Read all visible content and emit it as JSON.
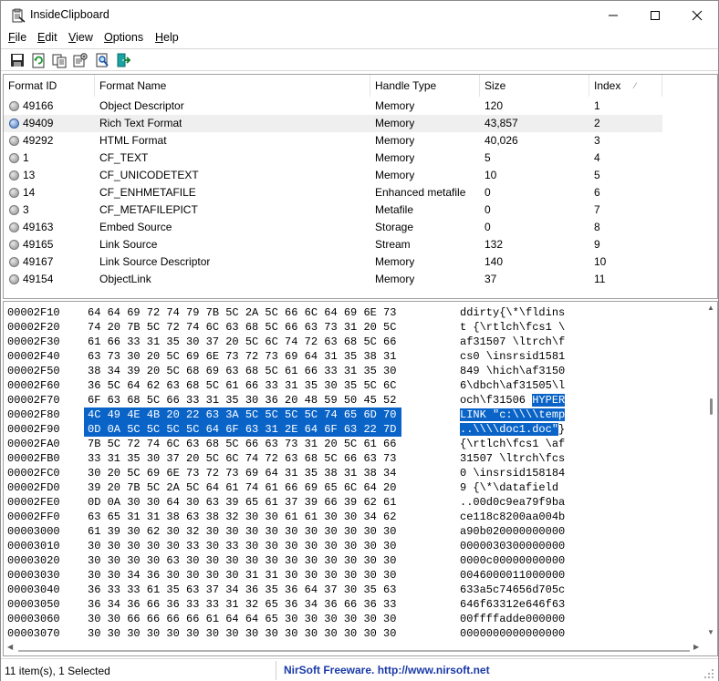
{
  "app": {
    "title": "InsideClipboard"
  },
  "menu": [
    {
      "label": "File",
      "key": "F",
      "rest": "ile"
    },
    {
      "label": "Edit",
      "key": "E",
      "rest": "dit"
    },
    {
      "label": "View",
      "key": "V",
      "rest": "iew"
    },
    {
      "label": "Options",
      "key": "O",
      "rest": "ptions"
    },
    {
      "label": "Help",
      "key": "H",
      "rest": "elp"
    }
  ],
  "toolbar": {
    "buttons": [
      "save-icon",
      "refresh-icon",
      "copy-icon",
      "properties-icon",
      "find-icon",
      "exit-icon"
    ]
  },
  "list": {
    "columns": [
      "Format ID",
      "Format Name",
      "Handle Type",
      "Size",
      "Index"
    ],
    "sort_indicator": "⁄",
    "rows": [
      {
        "id": "49166",
        "name": "Object Descriptor",
        "handle": "Memory",
        "size": "120",
        "index": "1",
        "icon": "circle",
        "selected": false
      },
      {
        "id": "49409",
        "name": "Rich Text Format",
        "handle": "Memory",
        "size": "43,857",
        "index": "2",
        "icon": "globe",
        "selected": true
      },
      {
        "id": "49292",
        "name": "HTML Format",
        "handle": "Memory",
        "size": "40,026",
        "index": "3",
        "icon": "circle",
        "selected": false
      },
      {
        "id": "1",
        "name": "CF_TEXT",
        "handle": "Memory",
        "size": "5",
        "index": "4",
        "icon": "circle",
        "selected": false
      },
      {
        "id": "13",
        "name": "CF_UNICODETEXT",
        "handle": "Memory",
        "size": "10",
        "index": "5",
        "icon": "circle",
        "selected": false
      },
      {
        "id": "14",
        "name": "CF_ENHMETAFILE",
        "handle": "Enhanced metafile",
        "size": "0",
        "index": "6",
        "icon": "circle",
        "selected": false
      },
      {
        "id": "3",
        "name": "CF_METAFILEPICT",
        "handle": "Metafile",
        "size": "0",
        "index": "7",
        "icon": "circle",
        "selected": false
      },
      {
        "id": "49163",
        "name": "Embed Source",
        "handle": "Storage",
        "size": "0",
        "index": "8",
        "icon": "circle",
        "selected": false
      },
      {
        "id": "49165",
        "name": "Link Source",
        "handle": "Stream",
        "size": "132",
        "index": "9",
        "icon": "circle",
        "selected": false
      },
      {
        "id": "49167",
        "name": "Link Source Descriptor",
        "handle": "Memory",
        "size": "140",
        "index": "10",
        "icon": "circle",
        "selected": false
      },
      {
        "id": "49154",
        "name": "ObjectLink",
        "handle": "Memory",
        "size": "37",
        "index": "11",
        "icon": "circle",
        "selected": false
      }
    ]
  },
  "hex": {
    "lines": [
      {
        "addr": "00002F10",
        "bytes": "64 64 69 72 74 79 7B 5C 2A 5C 66 6C 64 69 6E 73",
        "ascii": "ddirty{\\*\\fldins",
        "selected": false
      },
      {
        "addr": "00002F20",
        "bytes": "74 20 7B 5C 72 74 6C 63 68 5C 66 63 73 31 20 5C",
        "ascii": "t {\\rtlch\\fcs1 \\",
        "selected": false
      },
      {
        "addr": "00002F30",
        "bytes": "61 66 33 31 35 30 37 20 5C 6C 74 72 63 68 5C 66",
        "ascii": "af31507 \\ltrch\\f",
        "selected": false
      },
      {
        "addr": "00002F40",
        "bytes": "63 73 30 20 5C 69 6E 73 72 73 69 64 31 35 38 31",
        "ascii": "cs0 \\insrsid1581",
        "selected": false
      },
      {
        "addr": "00002F50",
        "bytes": "38 34 39 20 5C 68 69 63 68 5C 61 66 33 31 35 30",
        "ascii": "849 \\hich\\af3150",
        "selected": false
      },
      {
        "addr": "00002F60",
        "bytes": "36 5C 64 62 63 68 5C 61 66 33 31 35 30 35 5C 6C",
        "ascii": "6\\dbch\\af31505\\l",
        "selected": false
      },
      {
        "addr": "00002F70",
        "bytes": "6F 63 68 5C 66 33 31 35 30 36 20 48 59 50 45 52",
        "ascii": "och\\f31506 ",
        "ascii_sel": "HYPER",
        "selected": false
      },
      {
        "addr": "00002F80",
        "bytes": "4C 49 4E 4B 20 22 63 3A 5C 5C 5C 5C 74 65 6D 70",
        "ascii": "LINK \"c:\\\\\\\\temp",
        "selected": true
      },
      {
        "addr": "00002F90",
        "bytes": "0D 0A 5C 5C 5C 5C 64 6F 63 31 2E 64 6F 63 22 7D",
        "ascii": "..\\\\\\\\doc1.doc\"",
        "ascii_tail": "}",
        "selected": true
      },
      {
        "addr": "00002FA0",
        "bytes": "7B 5C 72 74 6C 63 68 5C 66 63 73 31 20 5C 61 66",
        "ascii": "{\\rtlch\\fcs1 \\af",
        "selected": false
      },
      {
        "addr": "00002FB0",
        "bytes": "33 31 35 30 37 20 5C 6C 74 72 63 68 5C 66 63 73",
        "ascii": "31507 \\ltrch\\fcs",
        "selected": false
      },
      {
        "addr": "00002FC0",
        "bytes": "30 20 5C 69 6E 73 72 73 69 64 31 35 38 31 38 34",
        "ascii": "0 \\insrsid158184",
        "selected": false
      },
      {
        "addr": "00002FD0",
        "bytes": "39 20 7B 5C 2A 5C 64 61 74 61 66 69 65 6C 64 20",
        "ascii": "9 {\\*\\datafield ",
        "selected": false
      },
      {
        "addr": "00002FE0",
        "bytes": "0D 0A 30 30 64 30 63 39 65 61 37 39 66 39 62 61",
        "ascii": "..00d0c9ea79f9ba",
        "selected": false
      },
      {
        "addr": "00002FF0",
        "bytes": "63 65 31 31 38 63 38 32 30 30 61 61 30 30 34 62",
        "ascii": "ce118c8200aa004b",
        "selected": false
      },
      {
        "addr": "00003000",
        "bytes": "61 39 30 62 30 32 30 30 30 30 30 30 30 30 30 30",
        "ascii": "a90b020000000000",
        "selected": false
      },
      {
        "addr": "00003010",
        "bytes": "30 30 30 30 30 33 30 33 30 30 30 30 30 30 30 30",
        "ascii": "0000030300000000",
        "selected": false
      },
      {
        "addr": "00003020",
        "bytes": "30 30 30 30 63 30 30 30 30 30 30 30 30 30 30 30",
        "ascii": "0000c00000000000",
        "selected": false
      },
      {
        "addr": "00003030",
        "bytes": "30 30 34 36 30 30 30 30 31 31 30 30 30 30 30 30",
        "ascii": "0046000011000000",
        "selected": false
      },
      {
        "addr": "00003040",
        "bytes": "36 33 33 61 35 63 37 34 36 35 36 64 37 30 35 63",
        "ascii": "633a5c74656d705c",
        "selected": false
      },
      {
        "addr": "00003050",
        "bytes": "36 34 36 66 36 33 33 31 32 65 36 34 36 66 36 33",
        "ascii": "646f63312e646f63",
        "selected": false
      },
      {
        "addr": "00003060",
        "bytes": "30 30 66 66 66 66 61 64 64 65 30 30 30 30 30 30",
        "ascii": "00ffffadde000000",
        "selected": false
      },
      {
        "addr": "00003070",
        "bytes": "30 30 30 30 30 30 30 30 30 30 30 30 30 30 30 30",
        "ascii": "0000000000000000",
        "selected": false
      }
    ]
  },
  "status": {
    "items": "11 item(s), 1 Selected",
    "brand": "NirSoft Freeware.  http://www.nirsoft.net"
  },
  "colors": {
    "selection": "#0a64c8",
    "selected_row": "#efefef",
    "brand_text": "#1a3aa8"
  }
}
